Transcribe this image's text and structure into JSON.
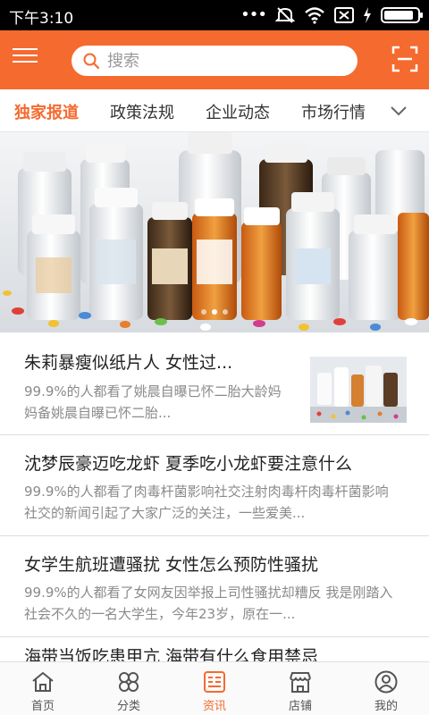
{
  "status_bar": {
    "time": "下午3:10",
    "dots": "•••",
    "battery_level": 0.9
  },
  "header": {
    "search_placeholder": "搜索"
  },
  "tabs": [
    {
      "label": "独家报道",
      "active": true
    },
    {
      "label": "政策法规",
      "active": false
    },
    {
      "label": "企业动态",
      "active": false
    },
    {
      "label": "市场行情",
      "active": false
    }
  ],
  "banner": {
    "slide_count": 3,
    "active_slide": 2
  },
  "feed": [
    {
      "title": "朱莉暴瘦似纸片人 女性过...",
      "desc": "99.9%的人都看了姚晨自曝已怀二胎大龄妈妈备姚晨自曝已怀二胎...",
      "has_thumb": true
    },
    {
      "title": "沈梦辰豪迈吃龙虾 夏季吃小龙虾要注意什么",
      "desc": "99.9%的人都看了肉毒杆菌影响社交注射肉毒杆肉毒杆菌影响社交的新闻引起了大家广泛的关注，一些爱美...",
      "has_thumb": false
    },
    {
      "title": "女学生航班遭骚扰 女性怎么预防性骚扰",
      "desc": "99.9%的人都看了女网友因举报上司性骚扰却糟反   我是刚踏入社会不久的一名大学生，今年23岁，原在一...",
      "has_thumb": false
    },
    {
      "title": "海带当饭吃患甲亢 海带有什么食用禁忌",
      "desc": "",
      "has_thumb": false
    }
  ],
  "bottom_nav": [
    {
      "label": "首页",
      "icon": "home-icon",
      "active": false
    },
    {
      "label": "分类",
      "icon": "category-icon",
      "active": false
    },
    {
      "label": "资讯",
      "icon": "news-icon",
      "active": true
    },
    {
      "label": "店铺",
      "icon": "store-icon",
      "active": false
    },
    {
      "label": "我的",
      "icon": "profile-icon",
      "active": false
    }
  ],
  "colors": {
    "accent": "#f56a2f",
    "status_bar": "#000000",
    "text": "#222222",
    "muted": "#8a8a8a"
  }
}
